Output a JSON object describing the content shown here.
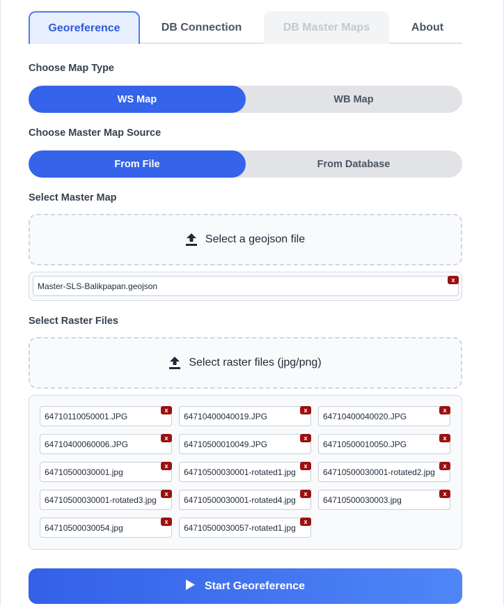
{
  "tabs": [
    {
      "label": "Georeference",
      "state": "active"
    },
    {
      "label": "DB Connection",
      "state": "normal"
    },
    {
      "label": "DB Master Maps",
      "state": "disabled"
    },
    {
      "label": "About",
      "state": "normal"
    }
  ],
  "map_type": {
    "label": "Choose Map Type",
    "options": [
      "WS Map",
      "WB Map"
    ],
    "selected": "WS Map"
  },
  "source": {
    "label": "Choose Master Map Source",
    "options": [
      "From File",
      "From Database"
    ],
    "selected": "From File"
  },
  "master_map": {
    "label": "Select Master Map",
    "drop_text": "Select a geojson file",
    "upload_icon": "upload-icon",
    "file": "Master-SLS-Balikpapan.geojson",
    "remove_label": "x"
  },
  "raster": {
    "label": "Select Raster Files",
    "drop_text": "Select raster files (jpg/png)",
    "upload_icon": "upload-icon",
    "remove_label": "x",
    "files": [
      "64710110050001.JPG",
      "64710400040019.JPG",
      "64710400040020.JPG",
      "64710400060006.JPG",
      "64710500010049.JPG",
      "64710500010050.JPG",
      "64710500030001.jpg",
      "64710500030001-rotated1.jpg",
      "64710500030001-rotated2.jpg",
      "64710500030001-rotated3.jpg",
      "64710500030001-rotated4.jpg",
      "64710500030003.jpg",
      "64710500030054.jpg",
      "64710500030057-rotated1.jpg"
    ]
  },
  "start_button": {
    "label": "Start Georeference",
    "icon": "play-icon"
  },
  "colors": {
    "accent": "#3563ea",
    "remove": "#9b1010",
    "disabled_text": "#c4c8cf"
  }
}
